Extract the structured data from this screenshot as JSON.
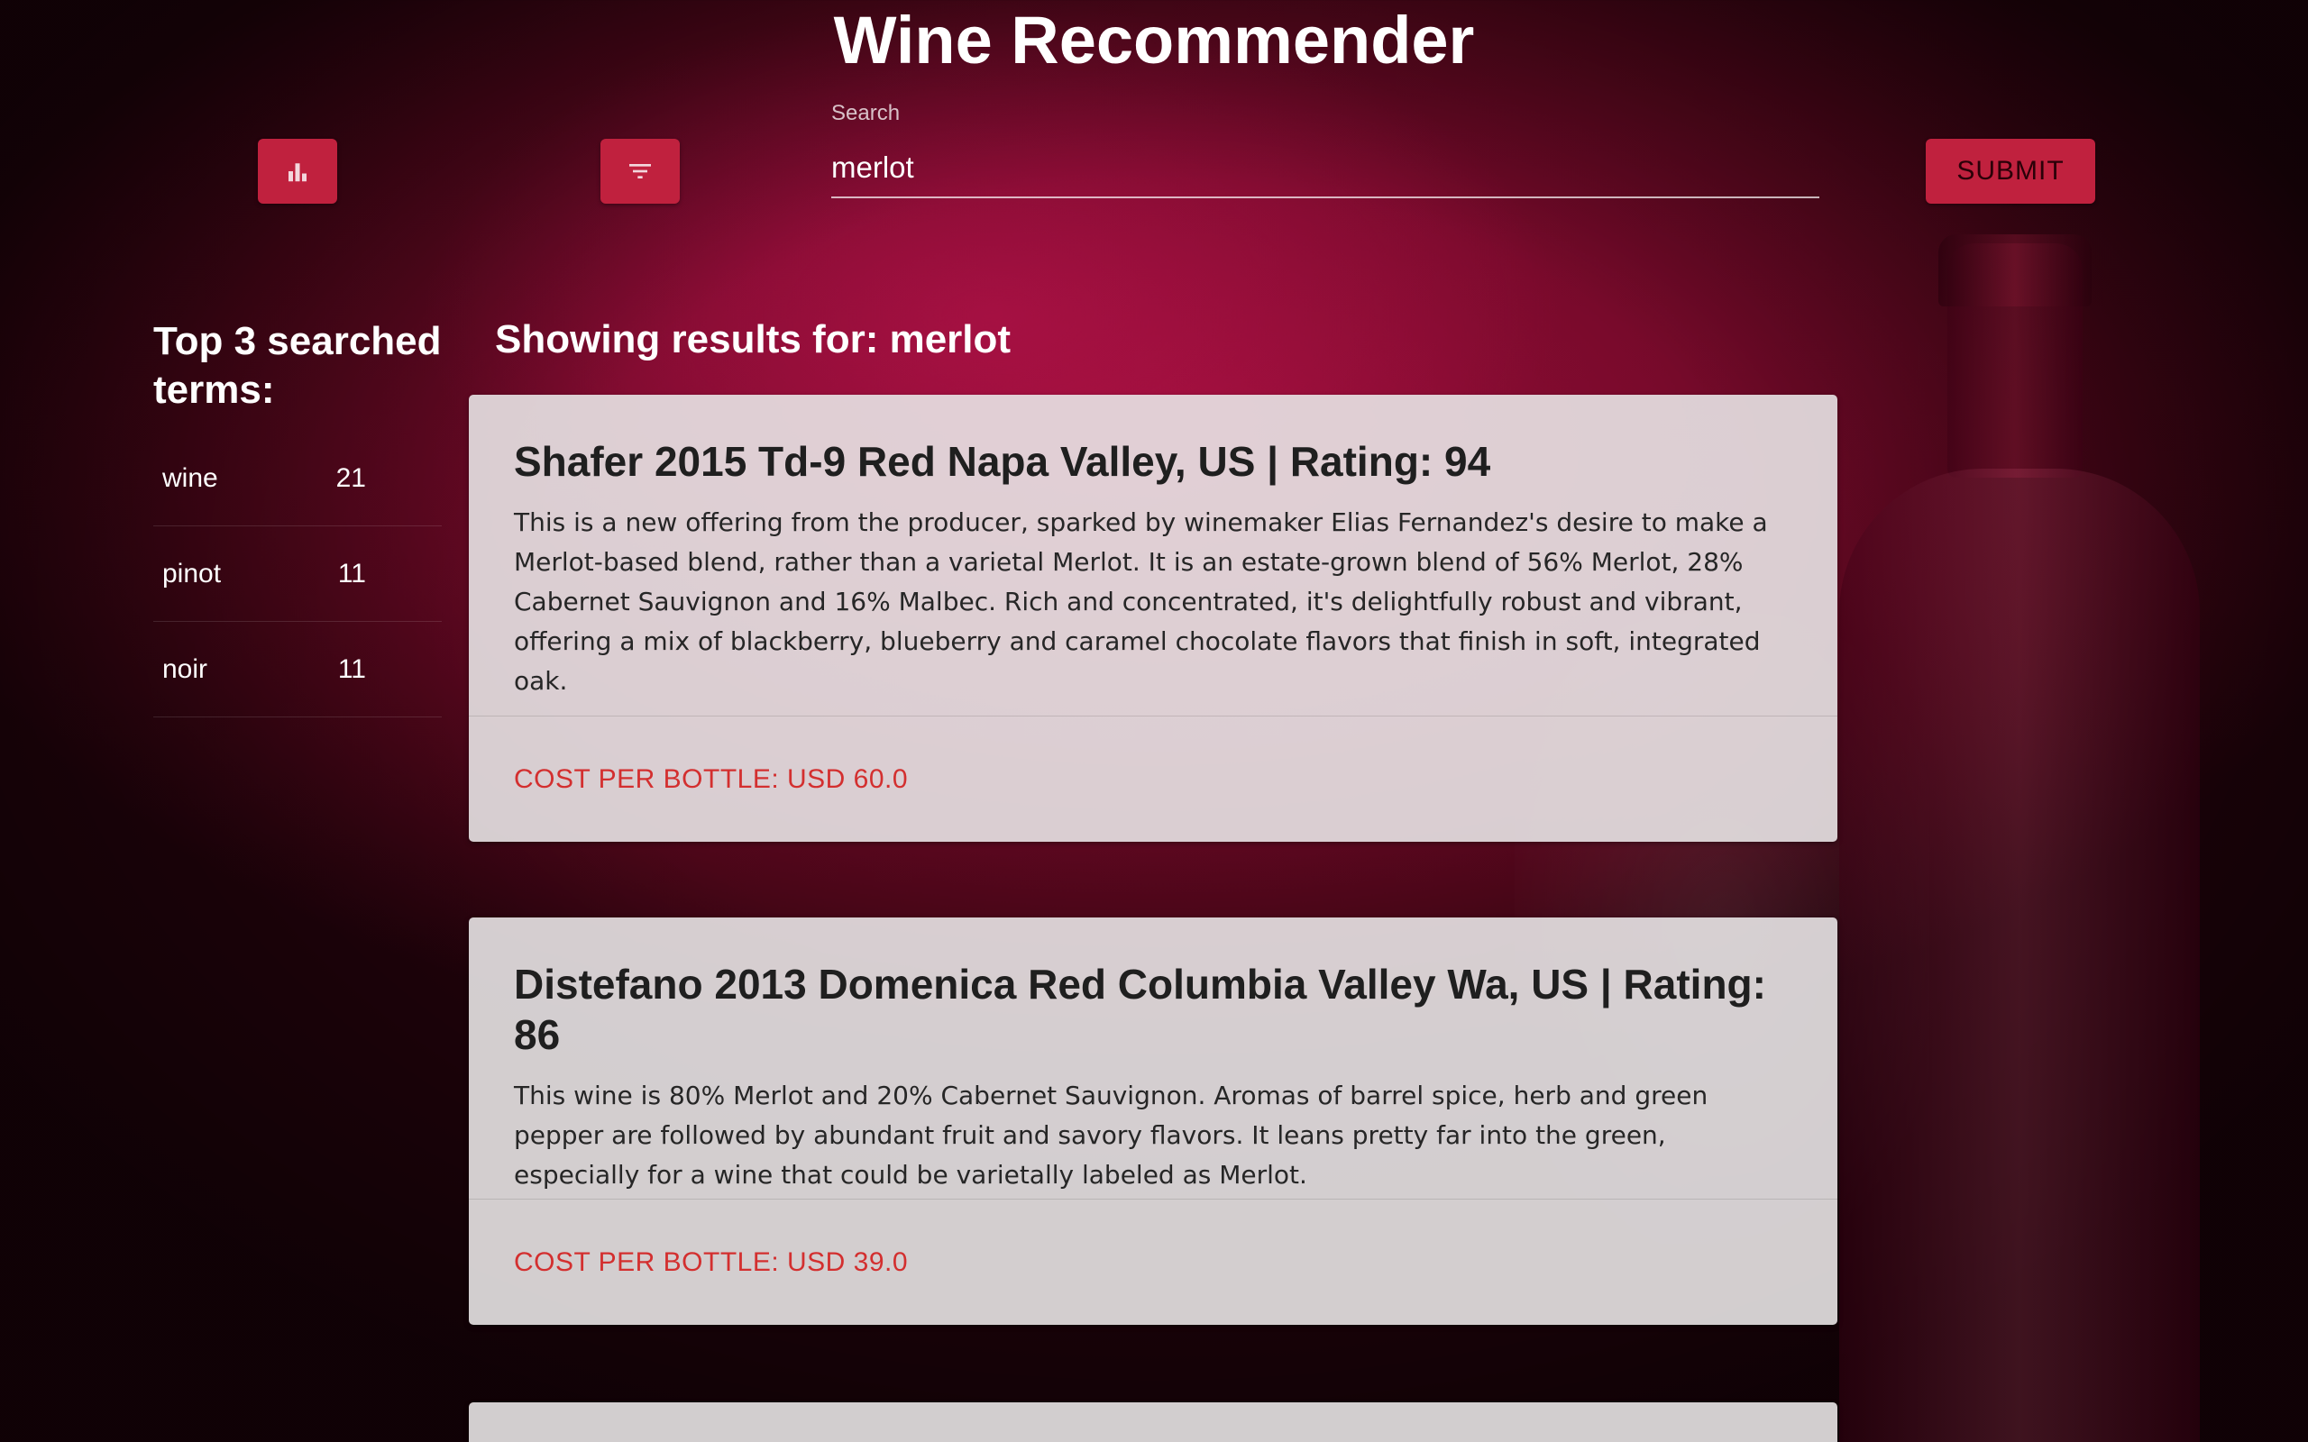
{
  "app": {
    "title": "Wine Recommender"
  },
  "toolbar": {
    "stats_icon": "bar-chart-icon",
    "filter_icon": "filter-icon",
    "search_label": "Search",
    "search_value": "merlot",
    "submit_label": "SUBMIT",
    "accent_color": "#c0213e"
  },
  "sidebar": {
    "title": "Top 3 searched terms:",
    "terms": [
      {
        "term": "wine",
        "count": "21"
      },
      {
        "term": "pinot",
        "count": "11"
      },
      {
        "term": "noir",
        "count": "11"
      }
    ]
  },
  "results": {
    "heading": "Showing results for: merlot",
    "items": [
      {
        "title": "Shafer 2015 Td-9 Red Napa Valley, US | Rating: 94",
        "description": "This is a new offering from the producer, sparked by winemaker Elias Fernandez's desire to make a Merlot-based blend, rather than a varietal Merlot. It is an estate-grown blend of 56% Merlot, 28% Cabernet Sauvignon and 16% Malbec. Rich and concentrated, it's delightfully robust and vibrant, offering a mix of blackberry, blueberry and caramel chocolate flavors that finish in soft, integrated oak.",
        "cost": "COST PER BOTTLE: USD 60.0"
      },
      {
        "title": "Distefano 2013 Domenica Red Columbia Valley Wa, US | Rating: 86",
        "description": "This wine is 80% Merlot and 20% Cabernet Sauvignon. Aromas of barrel spice, herb and green pepper are followed by abundant fruit and savory flavors. It leans pretty far into the green, especially for a wine that could be varietally labeled as Merlot.",
        "cost": "COST PER BOTTLE: USD 39.0"
      }
    ],
    "cost_color": "#d32f2f"
  }
}
